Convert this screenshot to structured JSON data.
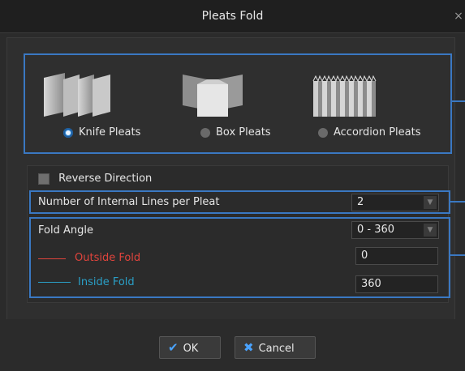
{
  "window": {
    "title": "Pleats Fold",
    "close_glyph": "×"
  },
  "pleat_types": {
    "options": [
      {
        "label": "Knife Pleats",
        "selected": true,
        "icon": "knife-pleats-icon"
      },
      {
        "label": "Box Pleats",
        "selected": false,
        "icon": "box-pleats-icon"
      },
      {
        "label": "Accordion Pleats",
        "selected": false,
        "icon": "accordion-pleats-icon"
      }
    ]
  },
  "options": {
    "reverse_direction_label": "Reverse Direction",
    "reverse_direction_checked": false,
    "internal_lines_label": "Number of Internal Lines per Pleat",
    "internal_lines_value": "2"
  },
  "fold_angle": {
    "label": "Fold Angle",
    "range_value": "0 - 360",
    "outside_label": "Outside Fold",
    "outside_value": "0",
    "outside_color": "#e0443c",
    "inside_label": "Inside Fold",
    "inside_value": "360",
    "inside_color": "#2a9fc6"
  },
  "buttons": {
    "ok_label": "OK",
    "cancel_label": "Cancel"
  },
  "colors": {
    "accent": "#3a78c2"
  }
}
